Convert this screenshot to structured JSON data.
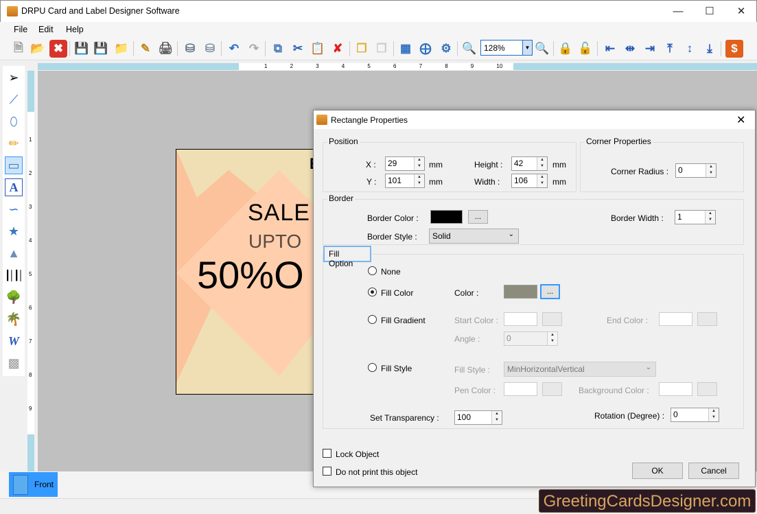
{
  "app": {
    "title": "DRPU Card and Label Designer Software",
    "window_controls": [
      "minimize",
      "maximize",
      "close"
    ]
  },
  "menu": {
    "items": [
      "File",
      "Edit",
      "Help"
    ]
  },
  "toolbar": {
    "zoom_value": "128%",
    "icons": [
      "new-icon",
      "open-icon",
      "close-file-icon",
      "save-icon",
      "save-as-icon",
      "export-icon",
      "edit-icon",
      "print-icon",
      "add-database-icon",
      "database-icon",
      "undo-icon",
      "redo-icon",
      "copy-icon",
      "cut-icon",
      "paste-icon",
      "delete-icon",
      "bring-front-icon",
      "send-back-icon",
      "grid-icon",
      "center-icon",
      "fit-icon",
      "zoom-in-icon",
      "zoom-out-icon",
      "lock-icon",
      "unlock-icon",
      "align-left-icon",
      "align-center-icon",
      "align-right-icon",
      "align-top-icon",
      "align-middle-icon",
      "align-bottom-icon",
      "buy-icon"
    ]
  },
  "ruler": {
    "h_labels": [
      "1",
      "2",
      "3",
      "4",
      "5",
      "6",
      "7",
      "8",
      "9",
      "10"
    ],
    "v_labels": [
      "1",
      "2",
      "3",
      "4",
      "5",
      "6",
      "7",
      "8",
      "9"
    ]
  },
  "tools": [
    "pointer",
    "line",
    "ellipse",
    "pencil",
    "rectangle",
    "text",
    "curve",
    "star",
    "triangle",
    "barcode",
    "image",
    "image-library",
    "word-art",
    "watermark"
  ],
  "card": {
    "line1": "SALE",
    "line2": "UPTO",
    "line3": "50%O",
    "corner": "E"
  },
  "tabs": {
    "front": "Front"
  },
  "brand": "GreetingCardsDesigner.com",
  "dialog": {
    "title": "Rectangle Properties",
    "position": {
      "label": "Position",
      "x_label": "X :",
      "x": "29",
      "y_label": "Y :",
      "y": "101",
      "height_label": "Height :",
      "height": "42",
      "width_label": "Width :",
      "width": "106",
      "unit": "mm"
    },
    "corner": {
      "label": "Corner Properties",
      "radius_label": "Corner Radius :",
      "radius": "0"
    },
    "border": {
      "label": "Border",
      "color_label": "Border Color :",
      "color": "#000000",
      "style_label": "Border Style :",
      "style": "Solid",
      "width_label": "Border Width :",
      "width": "1",
      "browse": "..."
    },
    "fill": {
      "label": "Fill Option",
      "none": "None",
      "fill_color": "Fill Color",
      "color_label": "Color :",
      "color": "#8c8c7c",
      "gradient": "Fill Gradient",
      "start_color": "Start Color :",
      "end_color": "End Color :",
      "angle_label": "Angle :",
      "angle": "0",
      "fill_style": "Fill Style",
      "style_label": "Fill Style :",
      "style": "MinHorizontalVertical",
      "pen_color": "Pen Color :",
      "bg_color": "Background Color :",
      "transparency_label": "Set Transparency :",
      "transparency": "100",
      "rotation_label": "Rotation (Degree) :",
      "rotation": "0",
      "selected": "Fill Color",
      "browse": "..."
    },
    "lock": "Lock Object",
    "noprint": "Do not print this object",
    "ok": "OK",
    "cancel": "Cancel"
  }
}
